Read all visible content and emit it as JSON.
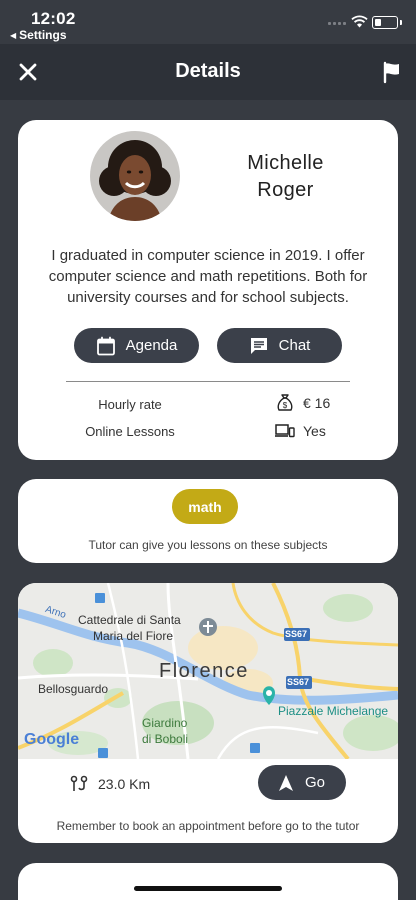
{
  "status_bar": {
    "time": "12:02",
    "back_label": "Settings"
  },
  "header": {
    "title": "Details"
  },
  "profile": {
    "name_first": "Michelle",
    "name_last": "Roger",
    "bio": "I graduated in computer science in 2019. I offer computer science and math repetitions. Both for university courses and for school subjects.",
    "agenda_label": "Agenda",
    "chat_label": "Chat",
    "hourly_rate_label": "Hourly rate",
    "hourly_rate_value": "€ 16",
    "online_lessons_label": "Online Lessons",
    "online_lessons_value": "Yes"
  },
  "subjects": {
    "items": [
      "math"
    ],
    "note": "Tutor can give you lessons on these subjects"
  },
  "map": {
    "labels": {
      "city": "Florence",
      "cathedral_1": "Cattedrale di Santa",
      "cathedral_2": "Maria del Fiore",
      "bellosguardo": "Bellosguardo",
      "giardino_1": "Giardino",
      "giardino_2": "di Boboli",
      "piazzale": "Piazzale Michelange",
      "river": "Arno",
      "road_1": "SS67",
      "road_2": "SS67"
    },
    "google": "Google",
    "distance": "23.0 Km",
    "go_label": "Go",
    "note": "Remember to book an appointment before go to the tutor"
  },
  "colors": {
    "background": "#373b42",
    "header": "#2d3138",
    "button": "#3b404a",
    "subject_chip": "#c3aa16"
  }
}
